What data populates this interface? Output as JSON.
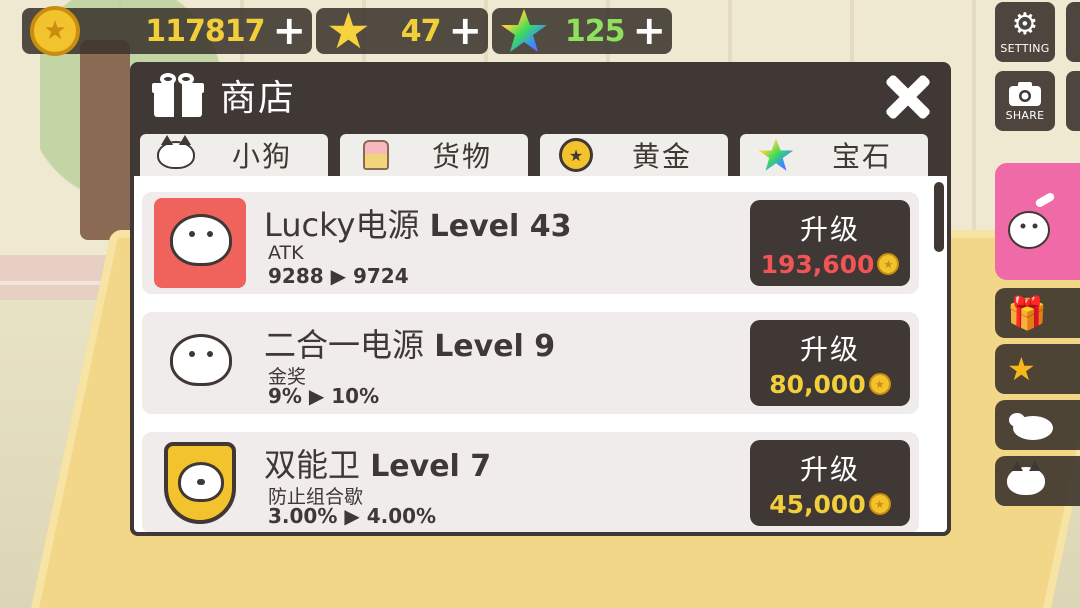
{
  "currency": {
    "coins": "117817",
    "stars": "47",
    "gems": "125",
    "plus": "+"
  },
  "right_panel": {
    "setting_label": "SETTING",
    "share_label": "SHARE"
  },
  "shop": {
    "title": "商店",
    "tabs": [
      {
        "label": "小狗",
        "icon": "cat-icon"
      },
      {
        "label": "货物",
        "icon": "cake-icon"
      },
      {
        "label": "黄金",
        "icon": "coin-icon"
      },
      {
        "label": "宝石",
        "icon": "rainbow-star-icon"
      }
    ],
    "items": [
      {
        "name": "Lucky电源",
        "level": "Level 43",
        "sub": "ATK",
        "stat": "9288 ▶ 9724",
        "button": "升级",
        "price": "193,600",
        "price_color": "#f05454"
      },
      {
        "name": "二合一电源",
        "level": "Level 9",
        "sub": "金奖",
        "stat": "9% ▶ 10%",
        "button": "升级",
        "price": "80,000",
        "price_color": "#f2cf3a"
      },
      {
        "name": "双能卫",
        "level": "Level 7",
        "sub": "防止组合歇",
        "stat": "3.00% ▶ 4.00%",
        "button": "升级",
        "price": "45,000",
        "price_color": "#f2cf3a"
      }
    ]
  },
  "colors": {
    "panel_dark": "#3f3834",
    "accent_yellow": "#f2cf3a",
    "price_red": "#f05454",
    "gem_green": "#8fe05d",
    "pink_tab": "#ef6aa6"
  }
}
